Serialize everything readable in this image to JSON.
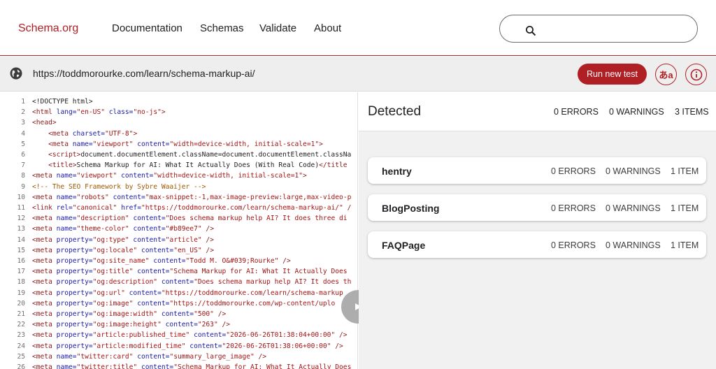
{
  "header": {
    "logo": "Schema.org",
    "nav": [
      "Documentation",
      "Schemas",
      "Validate",
      "About"
    ],
    "search_placeholder": ""
  },
  "urlbar": {
    "url": "https://toddmorourke.com/learn/schema-markup-ai/",
    "run_button": "Run new test",
    "lang_button": "あa"
  },
  "code": {
    "lines": [
      {
        "n": "1",
        "html": "&lt;!DOCTYPE html&gt;"
      },
      {
        "n": "2",
        "html": "<span class='t'>&lt;html</span> <span class='a'>lang=</span><span class='s'>\"en-US\"</span> <span class='a'>class=</span><span class='s'>\"no-js\"</span><span class='t'>&gt;</span>"
      },
      {
        "n": "3",
        "html": "<span class='t'>&lt;head&gt;</span>"
      },
      {
        "n": "4",
        "html": "    <span class='t'>&lt;meta</span> <span class='a'>charset=</span><span class='s'>\"UTF-8\"</span><span class='t'>&gt;</span>"
      },
      {
        "n": "5",
        "html": "    <span class='t'>&lt;meta</span> <span class='a'>name=</span><span class='s'>\"viewport\"</span> <span class='a'>content=</span><span class='s'>\"width=device-width, initial-scale=1\"</span><span class='t'>&gt;</span>"
      },
      {
        "n": "6",
        "html": "    <span class='t'>&lt;script&gt;</span>document.documentElement.className=document.documentElement.classNa"
      },
      {
        "n": "7",
        "html": "    <span class='t'>&lt;title&gt;</span>Schema Markup for AI: What It Actually Does (With Real Code)<span class='t'>&lt;/title</span>"
      },
      {
        "n": "8",
        "html": "<span class='t'>&lt;meta</span> <span class='a'>name=</span><span class='s'>\"viewport\"</span> <span class='a'>content=</span><span class='s'>\"width=device-width, initial-scale=1\"</span><span class='t'>&gt;</span>"
      },
      {
        "n": "9",
        "html": "<span class='c'>&lt;!-- The SEO Framework by Sybre Waaijer --&gt;</span>"
      },
      {
        "n": "10",
        "html": "<span class='t'>&lt;meta</span> <span class='a'>name=</span><span class='s'>\"robots\"</span> <span class='a'>content=</span><span class='s'>\"max-snippet:-1,max-image-preview:large,max-video-p</span>"
      },
      {
        "n": "11",
        "html": "<span class='t'>&lt;link</span> <span class='a'>rel=</span><span class='s'>\"canonical\"</span> <span class='a'>href=</span><span class='s'>\"https://toddmorourke.com/learn/schema-markup-ai/\"</span> <span class='t'>/</span>"
      },
      {
        "n": "12",
        "html": "<span class='t'>&lt;meta</span> <span class='a'>name=</span><span class='s'>\"description\"</span> <span class='a'>content=</span><span class='s'>\"Does schema markup help AI? It does three di</span>"
      },
      {
        "n": "13",
        "html": "<span class='t'>&lt;meta</span> <span class='a'>name=</span><span class='s'>\"theme-color\"</span> <span class='a'>content=</span><span class='s'>\"#b89ee7\"</span> <span class='t'>/&gt;</span>"
      },
      {
        "n": "14",
        "html": "<span class='t'>&lt;meta</span> <span class='a'>property=</span><span class='s'>\"og:type\"</span> <span class='a'>content=</span><span class='s'>\"article\"</span> <span class='t'>/&gt;</span>"
      },
      {
        "n": "15",
        "html": "<span class='t'>&lt;meta</span> <span class='a'>property=</span><span class='s'>\"og:locale\"</span> <span class='a'>content=</span><span class='s'>\"en_US\"</span> <span class='t'>/&gt;</span>"
      },
      {
        "n": "16",
        "html": "<span class='t'>&lt;meta</span> <span class='a'>property=</span><span class='s'>\"og:site_name\"</span> <span class='a'>content=</span><span class='s'>\"Todd M. O&amp;#039;Rourke\"</span> <span class='t'>/&gt;</span>"
      },
      {
        "n": "17",
        "html": "<span class='t'>&lt;meta</span> <span class='a'>property=</span><span class='s'>\"og:title\"</span> <span class='a'>content=</span><span class='s'>\"Schema Markup for AI: What It Actually Does</span>"
      },
      {
        "n": "18",
        "html": "<span class='t'>&lt;meta</span> <span class='a'>property=</span><span class='s'>\"og:description\"</span> <span class='a'>content=</span><span class='s'>\"Does schema markup help AI? It does th</span>"
      },
      {
        "n": "19",
        "html": "<span class='t'>&lt;meta</span> <span class='a'>property=</span><span class='s'>\"og:url\"</span> <span class='a'>content=</span><span class='s'>\"https://toddmorourke.com/learn/schema-markup</span>"
      },
      {
        "n": "20",
        "html": "<span class='t'>&lt;meta</span> <span class='a'>property=</span><span class='s'>\"og:image\"</span> <span class='a'>content=</span><span class='s'>\"https://toddmorourke.com/wp-content/uplo</span>"
      },
      {
        "n": "21",
        "html": "<span class='t'>&lt;meta</span> <span class='a'>property=</span><span class='s'>\"og:image:width\"</span> <span class='a'>content=</span><span class='s'>\"500\"</span> <span class='t'>/&gt;</span>"
      },
      {
        "n": "22",
        "html": "<span class='t'>&lt;meta</span> <span class='a'>property=</span><span class='s'>\"og:image:height\"</span> <span class='a'>content=</span><span class='s'>\"263\"</span> <span class='t'>/&gt;</span>"
      },
      {
        "n": "23",
        "html": "<span class='t'>&lt;meta</span> <span class='a'>property=</span><span class='s'>\"article:published_time\"</span> <span class='a'>content=</span><span class='s'>\"2026-06-26T01:38:04+00:00\"</span> <span class='t'>/&gt;</span>"
      },
      {
        "n": "24",
        "html": "<span class='t'>&lt;meta</span> <span class='a'>property=</span><span class='s'>\"article:modified_time\"</span> <span class='a'>content=</span><span class='s'>\"2026-06-26T01:38:06+00:00\"</span> <span class='t'>/&gt;</span>"
      },
      {
        "n": "25",
        "html": "<span class='t'>&lt;meta</span> <span class='a'>name=</span><span class='s'>\"twitter:card\"</span> <span class='a'>content=</span><span class='s'>\"summary_large_image\"</span> <span class='t'>/&gt;</span>"
      },
      {
        "n": "26",
        "html": "<span class='t'>&lt;meta</span> <span class='a'>name=</span><span class='s'>\"twitter:title\"</span> <span class='a'>content=</span><span class='s'>\"Schema Markup for AI: What It Actually Does</span>"
      }
    ]
  },
  "detected": {
    "title": "Detected",
    "errors": "0 ERRORS",
    "warnings": "0 WARNINGS",
    "items": "3 ITEMS",
    "cards": [
      {
        "name": "hentry",
        "errors": "0 ERRORS",
        "warnings": "0 WARNINGS",
        "items": "1 ITEM"
      },
      {
        "name": "BlogPosting",
        "errors": "0 ERRORS",
        "warnings": "0 WARNINGS",
        "items": "1 ITEM"
      },
      {
        "name": "FAQPage",
        "errors": "0 ERRORS",
        "warnings": "0 WARNINGS",
        "items": "1 ITEM"
      }
    ]
  },
  "colors": {
    "accent": "#b01f24",
    "panel_bg": "#f1f1f1",
    "urlbar_bg": "#eeeeee"
  },
  "icons": [
    "search-icon",
    "globe-icon",
    "info-icon",
    "play-icon"
  ]
}
